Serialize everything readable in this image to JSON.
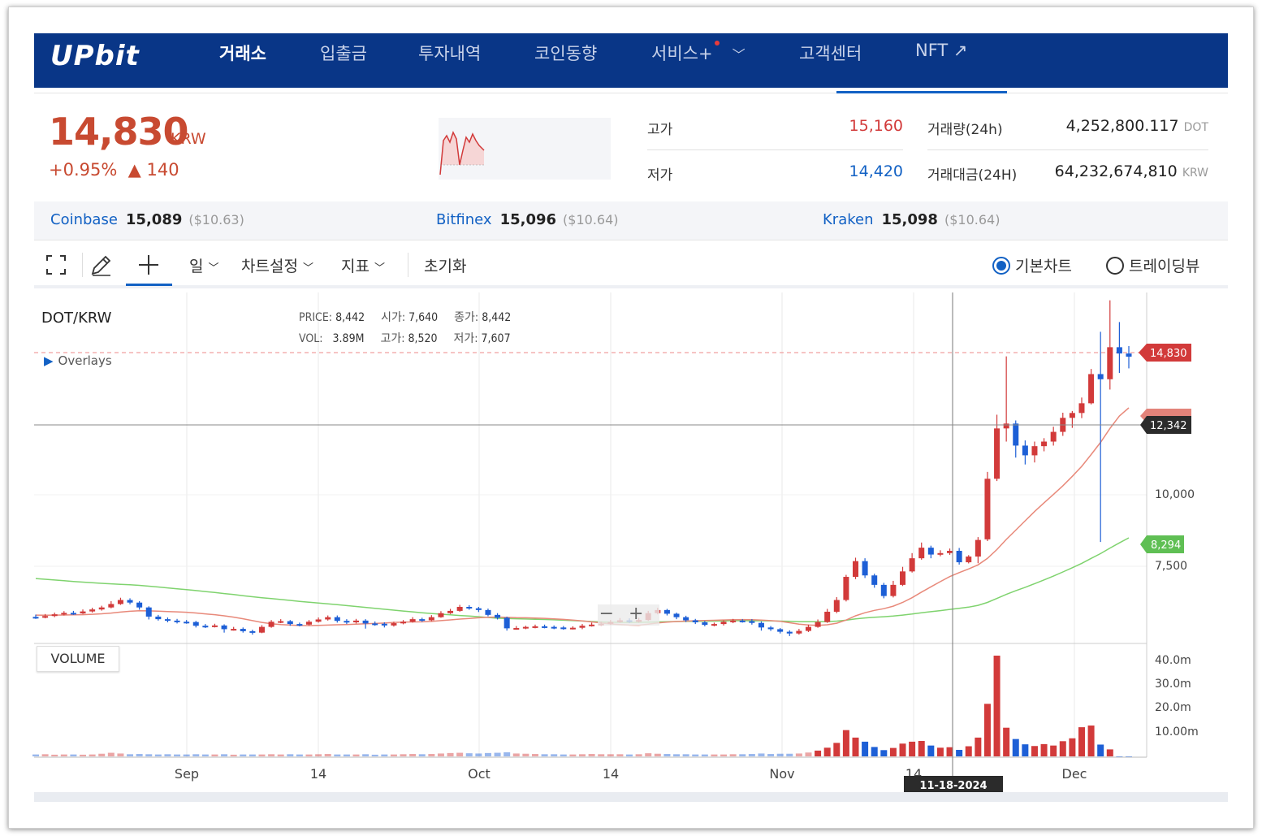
{
  "header": {
    "logo": "UPbit",
    "nav": [
      {
        "label": "거래소",
        "active": true
      },
      {
        "label": "입출금"
      },
      {
        "label": "투자내역"
      },
      {
        "label": "코인동향"
      },
      {
        "label": "서비스+"
      },
      {
        "label": "고객센터"
      },
      {
        "label": "NFT ↗"
      }
    ]
  },
  "ticker": {
    "price": "14,830",
    "unit": "KRW",
    "change_pct": "+0.95%",
    "change_abs": "▲ 140",
    "high_label": "고가",
    "high": "15,160",
    "low_label": "저가",
    "low": "14,420",
    "volume_label": "거래량(24h)",
    "volume": "4,252,800.117",
    "volume_unit": "DOT",
    "amount_label": "거래대금(24H)",
    "amount": "64,232,674,810",
    "amount_unit": "KRW"
  },
  "exchanges": [
    {
      "name": "Coinbase",
      "price": "15,089",
      "usd": "($10.63)"
    },
    {
      "name": "Bitfinex",
      "price": "15,096",
      "usd": "($10.64)"
    },
    {
      "name": "Kraken",
      "price": "15,098",
      "usd": "($10.64)"
    }
  ],
  "toolbar": {
    "period": "일",
    "chart_settings": "차트설정",
    "indicators": "지표",
    "reset": "초기화",
    "basic_chart": "기본차트",
    "tradingview": "트레이딩뷰"
  },
  "chart_info": {
    "pair": "DOT/KRW",
    "overlays": "Overlays",
    "price_k": "PRICE:",
    "price_v": "8,442",
    "open_k": "시가:",
    "open_v": "7,640",
    "close_k": "종가:",
    "close_v": "8,442",
    "vol_k": "VOL:",
    "vol_v": "3.89M",
    "high_k": "고가:",
    "high_v": "8,520",
    "low_k": "저가:",
    "low_v": "7,607",
    "volume_label": "VOLUME",
    "crosshair_date": "11-18-2024"
  },
  "colors": {
    "up": "#d23a3a",
    "down": "#1d5fd6",
    "navy": "#093687",
    "ma_short": "#e8897a",
    "ma_long": "#7fd36e"
  },
  "chart_data": {
    "type": "candlestick",
    "x_labels": [
      "Sep",
      "14",
      "Oct",
      "14",
      "Nov",
      "14",
      "Dec"
    ],
    "y_tick_labels": [
      "10,000",
      "7,500"
    ],
    "price_tags": {
      "last": "14,830",
      "crosshair": "12,342",
      "ma_long": "8,294"
    },
    "volume_tick_labels": [
      "40.0m",
      "30.0m",
      "20.0m",
      "10.00m"
    ],
    "ylim": [
      4500,
      17000
    ],
    "volume_ylim": [
      0,
      45
    ],
    "candles_note": "daily candles Aug–Dec 2024, approximate",
    "candles": [
      [
        5730,
        5700,
        5810,
        5660
      ],
      [
        5700,
        5760,
        5830,
        5680
      ],
      [
        5760,
        5820,
        5880,
        5720
      ],
      [
        5820,
        5870,
        5930,
        5780
      ],
      [
        5870,
        5850,
        5940,
        5800
      ],
      [
        5850,
        5920,
        5990,
        5830
      ],
      [
        5920,
        5990,
        6050,
        5880
      ],
      [
        5990,
        6060,
        6120,
        5950
      ],
      [
        6060,
        6180,
        6280,
        6030
      ],
      [
        6180,
        6320,
        6400,
        6150
      ],
      [
        6320,
        6230,
        6380,
        6170
      ],
      [
        6230,
        6060,
        6280,
        5980
      ],
      [
        6060,
        5740,
        6100,
        5640
      ],
      [
        5740,
        5650,
        5800,
        5600
      ],
      [
        5650,
        5600,
        5710,
        5540
      ],
      [
        5600,
        5560,
        5660,
        5500
      ],
      [
        5560,
        5550,
        5620,
        5490
      ],
      [
        5550,
        5420,
        5590,
        5360
      ],
      [
        5420,
        5400,
        5480,
        5340
      ],
      [
        5400,
        5430,
        5490,
        5360
      ],
      [
        5430,
        5300,
        5470,
        5180
      ],
      [
        5300,
        5310,
        5380,
        5250
      ],
      [
        5310,
        5230,
        5360,
        5180
      ],
      [
        5230,
        5180,
        5280,
        5110
      ],
      [
        5180,
        5380,
        5440,
        5160
      ],
      [
        5380,
        5560,
        5620,
        5350
      ],
      [
        5560,
        5580,
        5650,
        5510
      ],
      [
        5580,
        5480,
        5620,
        5420
      ],
      [
        5480,
        5460,
        5530,
        5400
      ],
      [
        5460,
        5560,
        5620,
        5430
      ],
      [
        5560,
        5640,
        5710,
        5530
      ],
      [
        5640,
        5720,
        5780,
        5600
      ],
      [
        5720,
        5590,
        5780,
        5530
      ],
      [
        5590,
        5540,
        5650,
        5480
      ],
      [
        5540,
        5600,
        5660,
        5500
      ],
      [
        5600,
        5500,
        5650,
        5320
      ],
      [
        5500,
        5490,
        5570,
        5420
      ],
      [
        5490,
        5430,
        5540,
        5360
      ],
      [
        5430,
        5510,
        5560,
        5390
      ],
      [
        5510,
        5560,
        5620,
        5470
      ],
      [
        5560,
        5650,
        5720,
        5530
      ],
      [
        5650,
        5610,
        5700,
        5560
      ],
      [
        5610,
        5720,
        5790,
        5580
      ],
      [
        5720,
        5860,
        5930,
        5700
      ],
      [
        5860,
        5940,
        6010,
        5830
      ],
      [
        5940,
        6080,
        6150,
        5910
      ],
      [
        6080,
        6030,
        6140,
        5980
      ],
      [
        6030,
        5970,
        6080,
        5900
      ],
      [
        5970,
        5800,
        6020,
        5750
      ],
      [
        5800,
        5700,
        5860,
        5640
      ],
      [
        5700,
        5330,
        5740,
        5250
      ],
      [
        5330,
        5340,
        5410,
        5280
      ],
      [
        5340,
        5380,
        5420,
        5300
      ],
      [
        5380,
        5400,
        5460,
        5330
      ],
      [
        5400,
        5380,
        5460,
        5330
      ],
      [
        5380,
        5360,
        5430,
        5300
      ],
      [
        5360,
        5330,
        5410,
        5280
      ],
      [
        5330,
        5350,
        5400,
        5290
      ],
      [
        5350,
        5420,
        5480,
        5300
      ],
      [
        5420,
        5460,
        5530,
        5390
      ],
      [
        5460,
        5490,
        5560,
        5420
      ],
      [
        5490,
        5550,
        5620,
        5450
      ],
      [
        5550,
        5610,
        5690,
        5520
      ],
      [
        5610,
        5560,
        5680,
        5510
      ],
      [
        5560,
        5620,
        5700,
        5530
      ],
      [
        5620,
        5860,
        5940,
        5590
      ],
      [
        5860,
        5970,
        6050,
        5820
      ],
      [
        5970,
        5840,
        6010,
        5780
      ],
      [
        5840,
        5720,
        5880,
        5650
      ],
      [
        5720,
        5610,
        5770,
        5550
      ],
      [
        5610,
        5540,
        5660,
        5480
      ],
      [
        5540,
        5450,
        5590,
        5400
      ],
      [
        5450,
        5480,
        5530,
        5400
      ],
      [
        5480,
        5560,
        5610,
        5430
      ],
      [
        5560,
        5600,
        5660,
        5510
      ],
      [
        5600,
        5580,
        5650,
        5530
      ],
      [
        5580,
        5520,
        5650,
        5460
      ],
      [
        5520,
        5360,
        5570,
        5250
      ],
      [
        5360,
        5300,
        5410,
        5240
      ],
      [
        5300,
        5210,
        5340,
        5150
      ],
      [
        5210,
        5150,
        5260,
        5060
      ],
      [
        5150,
        5240,
        5310,
        5110
      ],
      [
        5240,
        5380,
        5460,
        5200
      ],
      [
        5380,
        5550,
        5640,
        5350
      ],
      [
        5550,
        5910,
        6010,
        5520
      ],
      [
        5910,
        6320,
        6420,
        5860
      ],
      [
        6320,
        7130,
        7200,
        6270
      ],
      [
        7130,
        7680,
        7800,
        7050
      ],
      [
        7680,
        7180,
        7780,
        7090
      ],
      [
        7180,
        6850,
        7240,
        6750
      ],
      [
        6850,
        6460,
        6920,
        6380
      ],
      [
        6460,
        6850,
        6990,
        6410
      ],
      [
        6850,
        7320,
        7480,
        6810
      ],
      [
        7320,
        7780,
        7960,
        7280
      ],
      [
        7780,
        8150,
        8330,
        7730
      ],
      [
        8150,
        7910,
        8220,
        7780
      ],
      [
        7910,
        7960,
        8060,
        7850
      ],
      [
        7960,
        8040,
        8120,
        7900
      ],
      [
        8040,
        7640,
        8140,
        7560
      ],
      [
        7640,
        7840,
        7890,
        7600
      ],
      [
        7840,
        8420,
        8520,
        7607
      ],
      [
        8442,
        10560,
        10800,
        8380
      ],
      [
        10560,
        12320,
        12800,
        10480
      ],
      [
        12320,
        12490,
        14840,
        11860
      ],
      [
        12490,
        11720,
        12600,
        11300
      ],
      [
        11720,
        11380,
        11900,
        11060
      ],
      [
        11380,
        11700,
        11860,
        11130
      ],
      [
        11700,
        11860,
        11980,
        11520
      ],
      [
        11860,
        12200,
        12380,
        11720
      ],
      [
        12200,
        12690,
        12870,
        12060
      ],
      [
        12690,
        12860,
        12930,
        12340
      ],
      [
        12860,
        13200,
        13400,
        12680
      ],
      [
        13200,
        14220,
        14400,
        13160
      ],
      [
        14220,
        14040,
        15700,
        8350
      ],
      [
        14040,
        15160,
        16800,
        13680
      ],
      [
        15160,
        14940,
        16040,
        14260
      ],
      [
        14940,
        14830,
        15200,
        14420
      ]
    ],
    "volume_values": [
      0.8,
      0.9,
      0.7,
      0.8,
      0.8,
      0.7,
      0.8,
      1.1,
      1.5,
      1.2,
      0.9,
      1.0,
      0.9,
      0.8,
      0.9,
      0.8,
      0.8,
      0.9,
      0.8,
      0.8,
      0.9,
      0.7,
      0.8,
      0.8,
      0.8,
      0.9,
      0.8,
      0.9,
      0.8,
      0.8,
      0.9,
      1.0,
      0.8,
      0.8,
      0.8,
      0.9,
      0.7,
      0.8,
      0.8,
      0.9,
      1.0,
      0.9,
      1.0,
      1.2,
      1.4,
      1.5,
      1.3,
      1.2,
      1.4,
      1.5,
      1.7,
      1.2,
      1.1,
      1.0,
      0.9,
      0.9,
      0.8,
      0.8,
      0.9,
      1.0,
      0.9,
      0.9,
      0.9,
      0.8,
      0.9,
      1.3,
      1.1,
      1.0,
      0.9,
      0.9,
      0.8,
      0.8,
      0.8,
      0.8,
      0.9,
      0.9,
      1.0,
      1.2,
      1.0,
      1.1,
      1.1,
      1.2,
      1.6,
      2.4,
      3.6,
      5.6,
      10.9,
      7.8,
      6.1,
      3.9,
      2.6,
      3.5,
      5.3,
      6.1,
      6.4,
      4.5,
      3.6,
      3.8,
      2.7,
      4.2,
      7.8,
      21.8,
      41.8,
      11.9,
      7.2,
      5.0,
      4.3,
      5.1,
      4.5,
      6.3,
      7.5,
      12.1,
      12.8,
      4.9,
      2.9
    ]
  }
}
